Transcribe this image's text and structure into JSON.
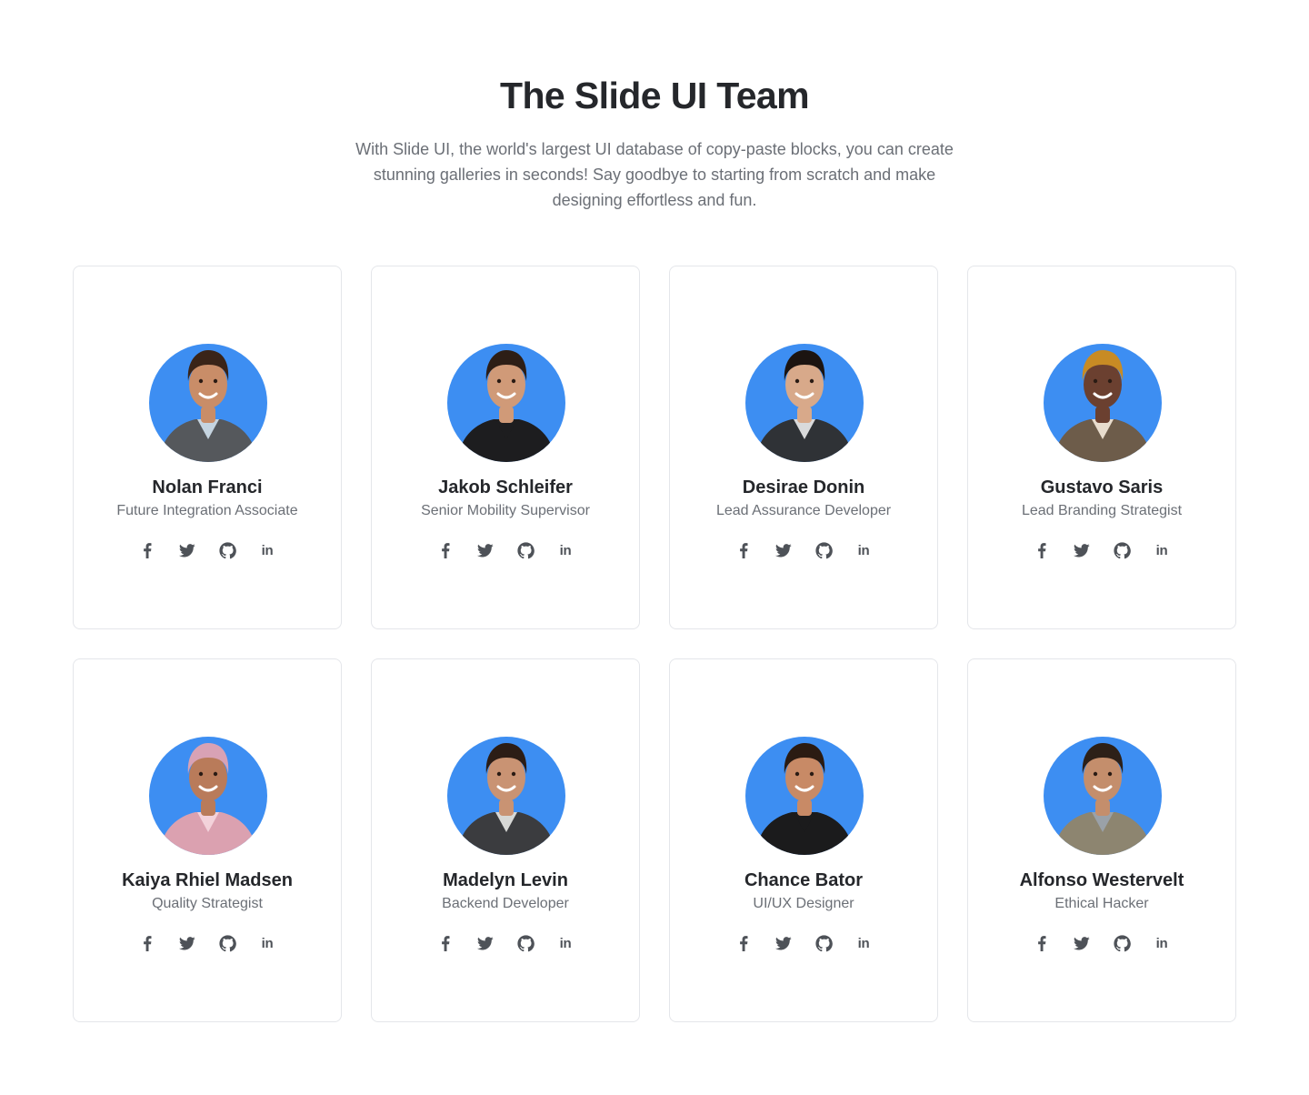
{
  "header": {
    "title": "The Slide UI Team",
    "subtitle": "With Slide UI, the world's largest UI database of copy-paste blocks, you can create stunning galleries in seconds! Say goodbye to starting from scratch and make designing effortless and fun."
  },
  "colors": {
    "avatar_background": "#3d8ef2",
    "icon": "#4e5258",
    "card_border": "#e4e6ea"
  },
  "social_icons": [
    "facebook-icon",
    "twitter-icon",
    "github-icon",
    "linkedin-icon"
  ],
  "social_labels": {
    "linkedin": "in"
  },
  "members": [
    {
      "name": "Nolan Franci",
      "role": "Future Integration Associate",
      "skin": "#c98d68",
      "hair": "#3a2418",
      "shirt": "#55585c",
      "inner": "#c5d4e0"
    },
    {
      "name": "Jakob Schleifer",
      "role": "Senior Mobility Supervisor",
      "skin": "#d09a78",
      "hair": "#2d1e16",
      "shirt": "#1d1d1f",
      "inner": "#1d1d1f"
    },
    {
      "name": "Desirae Donin",
      "role": "Lead Assurance Developer",
      "skin": "#d8a98a",
      "hair": "#1c1411",
      "shirt": "#2f3236",
      "inner": "#d9dadb"
    },
    {
      "name": "Gustavo Saris",
      "role": "Lead Branding Strategist",
      "skin": "#6b4030",
      "hair": "#c88b24",
      "shirt": "#6d5c4a",
      "inner": "#e8dccd"
    },
    {
      "name": "Kaiya Rhiel Madsen",
      "role": "Quality Strategist",
      "skin": "#b97b5a",
      "hair": "#d8a2b5",
      "shirt": "#dba1b0",
      "inner": "#f3d2da"
    },
    {
      "name": "Madelyn Levin",
      "role": "Backend Developer",
      "skin": "#c99373",
      "hair": "#2c1d16",
      "shirt": "#3b3c3f",
      "inner": "#d7d8d6"
    },
    {
      "name": "Chance Bator",
      "role": "UI/UX Designer",
      "skin": "#c88a66",
      "hair": "#2b1b12",
      "shirt": "#1b1b1c",
      "inner": "#1b1b1c"
    },
    {
      "name": "Alfonso Westervelt",
      "role": "Ethical Hacker",
      "skin": "#c48e6c",
      "hair": "#2d2018",
      "shirt": "#8d8570",
      "inner": "#9aa1a8"
    }
  ]
}
